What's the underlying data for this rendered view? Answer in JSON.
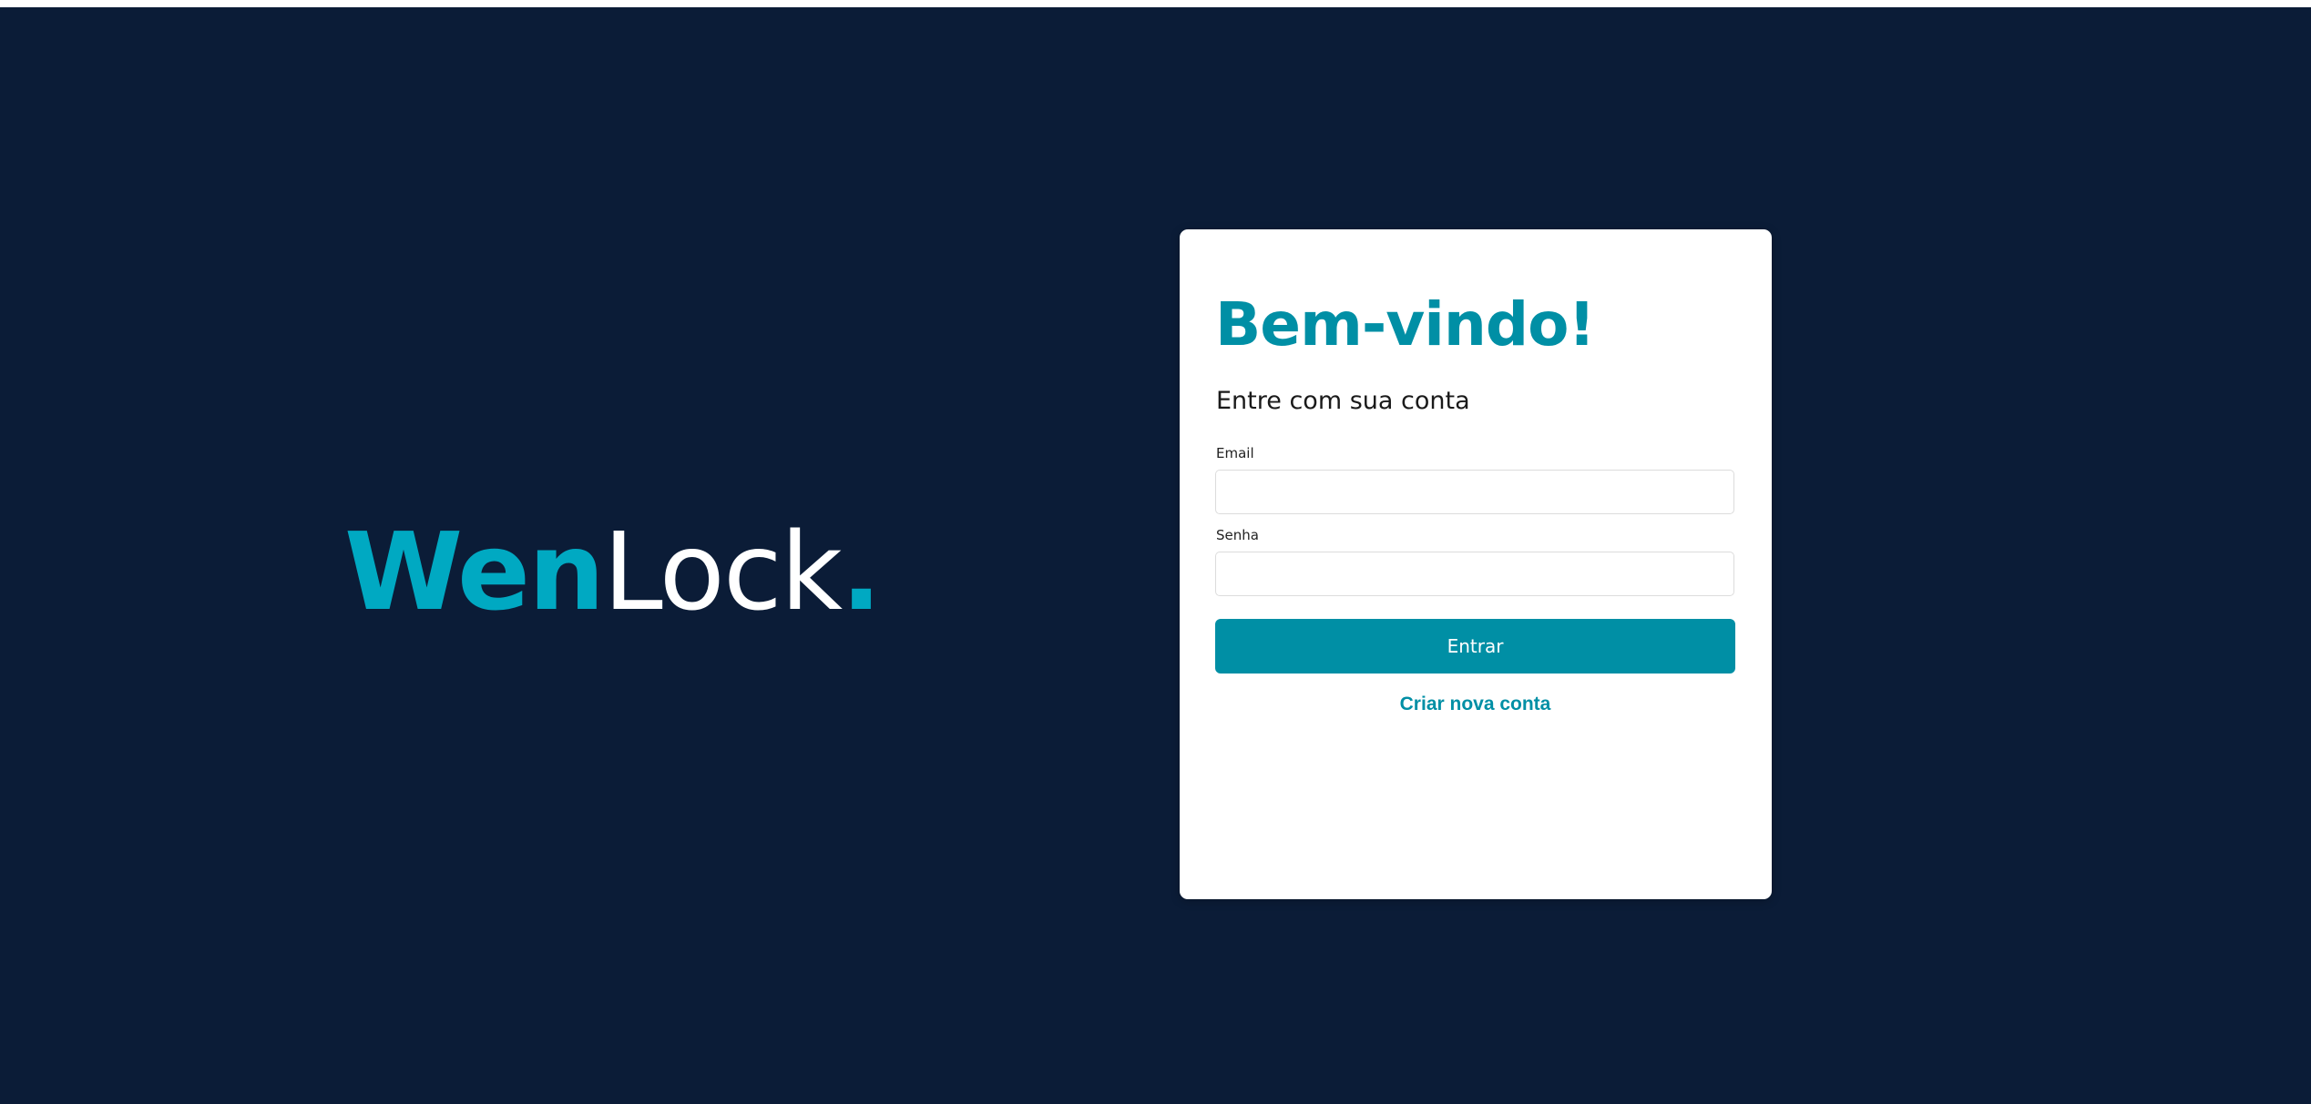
{
  "brand": {
    "part1": "Wen",
    "part2": "Lock",
    "part3": ".",
    "colors": {
      "accent": "#00a9c2",
      "text": "#ffffff",
      "background": "#0b1c37"
    }
  },
  "login": {
    "title": "Bem-vindo!",
    "subtitle": "Entre com sua conta",
    "email_label": "Email",
    "email_value": "",
    "password_label": "Senha",
    "password_value": "",
    "submit_label": "Entrar",
    "create_account_label": "Criar nova conta",
    "colors": {
      "primary": "#008fa5",
      "card": "#ffffff"
    }
  }
}
